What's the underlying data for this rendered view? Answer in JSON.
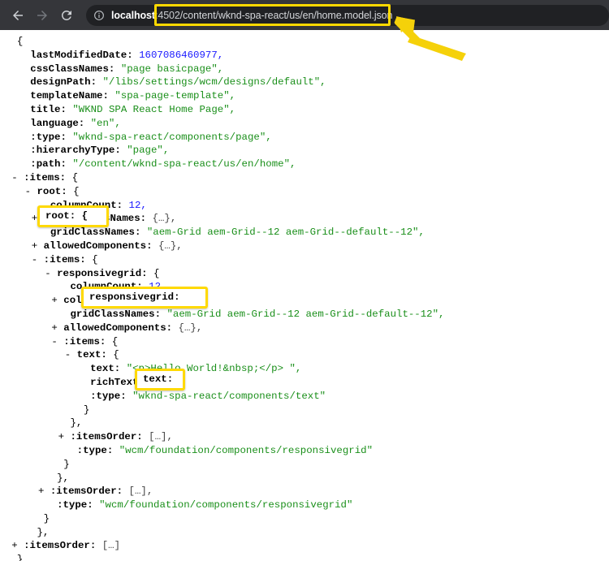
{
  "browser": {
    "back_label": "Back",
    "forward_label": "Forward",
    "reload_label": "Reload",
    "site_info_label": "View site information",
    "url": {
      "host": "localhost",
      "port": ":4502",
      "path": "/content/wknd-spa-react/us/en/home.model.json",
      "full": "localhost:4502/content/wknd-spa-react/us/en/home.model.json"
    }
  },
  "annotations": {
    "highlight_color": "#ffd900",
    "arrow_color": "#f5d10a",
    "boxes": [
      {
        "name": "url-box",
        "text": "/content/wknd-spa-react/us/en/home.model.json"
      },
      {
        "name": "root-box",
        "text": "root: {"
      },
      {
        "name": "responsivegrid-box",
        "text": "responsivegrid: {"
      },
      {
        "name": "text-box",
        "text": "text: {"
      }
    ]
  },
  "json_lines": [
    {
      "indent": 0,
      "toggle": "",
      "text": "{"
    },
    {
      "indent": 2,
      "toggle": "",
      "key": "lastModifiedDate",
      "value": "1607086460977",
      "type": "num",
      "comma": true
    },
    {
      "indent": 2,
      "toggle": "",
      "key": "cssClassNames",
      "value": "\"page basicpage\"",
      "type": "str",
      "comma": true
    },
    {
      "indent": 2,
      "toggle": "",
      "key": "designPath",
      "value": "\"/libs/settings/wcm/designs/default\"",
      "type": "str",
      "comma": true
    },
    {
      "indent": 2,
      "toggle": "",
      "key": "templateName",
      "value": "\"spa-page-template\"",
      "type": "str",
      "comma": true
    },
    {
      "indent": 2,
      "toggle": "",
      "key": "title",
      "value": "\"WKND SPA React Home Page\"",
      "type": "str",
      "comma": true
    },
    {
      "indent": 2,
      "toggle": "",
      "key": "language",
      "value": "\"en\"",
      "type": "str",
      "comma": true
    },
    {
      "indent": 2,
      "toggle": "",
      "key": ":type",
      "value": "\"wknd-spa-react/components/page\"",
      "type": "str",
      "comma": true
    },
    {
      "indent": 2,
      "toggle": "",
      "key": ":hierarchyType",
      "value": "\"page\"",
      "type": "str",
      "comma": true
    },
    {
      "indent": 2,
      "toggle": "",
      "key": ":path",
      "value": "\"/content/wknd-spa-react/us/en/home\"",
      "type": "str",
      "comma": true
    },
    {
      "indent": 1,
      "toggle": "-",
      "key": ":items",
      "value": "{",
      "type": "punc",
      "comma": false
    },
    {
      "indent": 3,
      "toggle": "-",
      "key": "root",
      "value": "{",
      "type": "punc",
      "comma": false
    },
    {
      "indent": 5,
      "toggle": "",
      "key": "columnCount",
      "value": "12",
      "type": "num",
      "comma": true
    },
    {
      "indent": 4,
      "toggle": "+",
      "key": "columnClassNames",
      "value": "{…},",
      "type": "ellip",
      "comma": false
    },
    {
      "indent": 5,
      "toggle": "",
      "key": "gridClassNames",
      "value": "\"aem-Grid aem-Grid--12 aem-Grid--default--12\"",
      "type": "str",
      "comma": true
    },
    {
      "indent": 4,
      "toggle": "+",
      "key": "allowedComponents",
      "value": "{…},",
      "type": "ellip",
      "comma": false
    },
    {
      "indent": 4,
      "toggle": "-",
      "key": ":items",
      "value": "{",
      "type": "punc",
      "comma": false
    },
    {
      "indent": 6,
      "toggle": "-",
      "key": "responsivegrid",
      "value": "{",
      "type": "punc",
      "comma": false
    },
    {
      "indent": 8,
      "toggle": "",
      "key": "columnCount",
      "value": "12",
      "type": "num",
      "comma": true
    },
    {
      "indent": 7,
      "toggle": "+",
      "key": "columnClassNames",
      "value": "{…},",
      "type": "ellip",
      "comma": false
    },
    {
      "indent": 8,
      "toggle": "",
      "key": "gridClassNames",
      "value": "\"aem-Grid aem-Grid--12 aem-Grid--default--12\"",
      "type": "str",
      "comma": true
    },
    {
      "indent": 7,
      "toggle": "+",
      "key": "allowedComponents",
      "value": "{…},",
      "type": "ellip",
      "comma": false
    },
    {
      "indent": 7,
      "toggle": "-",
      "key": ":items",
      "value": "{",
      "type": "punc",
      "comma": false
    },
    {
      "indent": 9,
      "toggle": "-",
      "key": "text",
      "value": "{",
      "type": "punc",
      "comma": false
    },
    {
      "indent": 11,
      "toggle": "",
      "key": "text",
      "value": "\"<p>Hello World!&nbsp;</p> \"",
      "type": "str",
      "comma": true
    },
    {
      "indent": 11,
      "toggle": "",
      "key": "richText",
      "value": "true",
      "type": "bool",
      "comma": true
    },
    {
      "indent": 11,
      "toggle": "",
      "key": ":type",
      "value": "\"wknd-spa-react/components/text\"",
      "type": "str",
      "comma": false
    },
    {
      "indent": 10,
      "toggle": "",
      "text": "}"
    },
    {
      "indent": 8,
      "toggle": "",
      "text": "},"
    },
    {
      "indent": 8,
      "toggle": "+",
      "key": ":itemsOrder",
      "value": "[…],",
      "type": "ellip",
      "comma": false
    },
    {
      "indent": 9,
      "toggle": "",
      "key": ":type",
      "value": "\"wcm/foundation/components/responsivegrid\"",
      "type": "str",
      "comma": false
    },
    {
      "indent": 7,
      "toggle": "",
      "text": "}"
    },
    {
      "indent": 6,
      "toggle": "",
      "text": "},"
    },
    {
      "indent": 5,
      "toggle": "+",
      "key": ":itemsOrder",
      "value": "[…],",
      "type": "ellip",
      "comma": false
    },
    {
      "indent": 6,
      "toggle": "",
      "key": ":type",
      "value": "\"wcm/foundation/components/responsivegrid\"",
      "type": "str",
      "comma": false
    },
    {
      "indent": 4,
      "toggle": "",
      "text": "}"
    },
    {
      "indent": 3,
      "toggle": "",
      "text": "},"
    },
    {
      "indent": 1,
      "toggle": "+",
      "key": ":itemsOrder",
      "value": "[…]",
      "type": "ellip",
      "comma": false
    },
    {
      "indent": 0,
      "toggle": "",
      "text": "}"
    }
  ]
}
